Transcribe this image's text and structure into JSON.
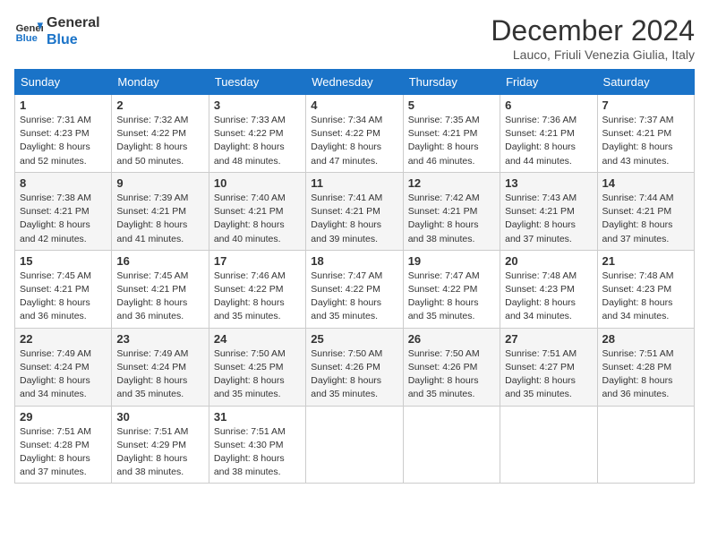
{
  "header": {
    "logo_line1": "General",
    "logo_line2": "Blue",
    "month_title": "December 2024",
    "subtitle": "Lauco, Friuli Venezia Giulia, Italy"
  },
  "weekdays": [
    "Sunday",
    "Monday",
    "Tuesday",
    "Wednesday",
    "Thursday",
    "Friday",
    "Saturday"
  ],
  "weeks": [
    [
      {
        "day": "1",
        "lines": [
          "Sunrise: 7:31 AM",
          "Sunset: 4:23 PM",
          "Daylight: 8 hours",
          "and 52 minutes."
        ]
      },
      {
        "day": "2",
        "lines": [
          "Sunrise: 7:32 AM",
          "Sunset: 4:22 PM",
          "Daylight: 8 hours",
          "and 50 minutes."
        ]
      },
      {
        "day": "3",
        "lines": [
          "Sunrise: 7:33 AM",
          "Sunset: 4:22 PM",
          "Daylight: 8 hours",
          "and 48 minutes."
        ]
      },
      {
        "day": "4",
        "lines": [
          "Sunrise: 7:34 AM",
          "Sunset: 4:22 PM",
          "Daylight: 8 hours",
          "and 47 minutes."
        ]
      },
      {
        "day": "5",
        "lines": [
          "Sunrise: 7:35 AM",
          "Sunset: 4:21 PM",
          "Daylight: 8 hours",
          "and 46 minutes."
        ]
      },
      {
        "day": "6",
        "lines": [
          "Sunrise: 7:36 AM",
          "Sunset: 4:21 PM",
          "Daylight: 8 hours",
          "and 44 minutes."
        ]
      },
      {
        "day": "7",
        "lines": [
          "Sunrise: 7:37 AM",
          "Sunset: 4:21 PM",
          "Daylight: 8 hours",
          "and 43 minutes."
        ]
      }
    ],
    [
      {
        "day": "8",
        "lines": [
          "Sunrise: 7:38 AM",
          "Sunset: 4:21 PM",
          "Daylight: 8 hours",
          "and 42 minutes."
        ]
      },
      {
        "day": "9",
        "lines": [
          "Sunrise: 7:39 AM",
          "Sunset: 4:21 PM",
          "Daylight: 8 hours",
          "and 41 minutes."
        ]
      },
      {
        "day": "10",
        "lines": [
          "Sunrise: 7:40 AM",
          "Sunset: 4:21 PM",
          "Daylight: 8 hours",
          "and 40 minutes."
        ]
      },
      {
        "day": "11",
        "lines": [
          "Sunrise: 7:41 AM",
          "Sunset: 4:21 PM",
          "Daylight: 8 hours",
          "and 39 minutes."
        ]
      },
      {
        "day": "12",
        "lines": [
          "Sunrise: 7:42 AM",
          "Sunset: 4:21 PM",
          "Daylight: 8 hours",
          "and 38 minutes."
        ]
      },
      {
        "day": "13",
        "lines": [
          "Sunrise: 7:43 AM",
          "Sunset: 4:21 PM",
          "Daylight: 8 hours",
          "and 37 minutes."
        ]
      },
      {
        "day": "14",
        "lines": [
          "Sunrise: 7:44 AM",
          "Sunset: 4:21 PM",
          "Daylight: 8 hours",
          "and 37 minutes."
        ]
      }
    ],
    [
      {
        "day": "15",
        "lines": [
          "Sunrise: 7:45 AM",
          "Sunset: 4:21 PM",
          "Daylight: 8 hours",
          "and 36 minutes."
        ]
      },
      {
        "day": "16",
        "lines": [
          "Sunrise: 7:45 AM",
          "Sunset: 4:21 PM",
          "Daylight: 8 hours",
          "and 36 minutes."
        ]
      },
      {
        "day": "17",
        "lines": [
          "Sunrise: 7:46 AM",
          "Sunset: 4:22 PM",
          "Daylight: 8 hours",
          "and 35 minutes."
        ]
      },
      {
        "day": "18",
        "lines": [
          "Sunrise: 7:47 AM",
          "Sunset: 4:22 PM",
          "Daylight: 8 hours",
          "and 35 minutes."
        ]
      },
      {
        "day": "19",
        "lines": [
          "Sunrise: 7:47 AM",
          "Sunset: 4:22 PM",
          "Daylight: 8 hours",
          "and 35 minutes."
        ]
      },
      {
        "day": "20",
        "lines": [
          "Sunrise: 7:48 AM",
          "Sunset: 4:23 PM",
          "Daylight: 8 hours",
          "and 34 minutes."
        ]
      },
      {
        "day": "21",
        "lines": [
          "Sunrise: 7:48 AM",
          "Sunset: 4:23 PM",
          "Daylight: 8 hours",
          "and 34 minutes."
        ]
      }
    ],
    [
      {
        "day": "22",
        "lines": [
          "Sunrise: 7:49 AM",
          "Sunset: 4:24 PM",
          "Daylight: 8 hours",
          "and 34 minutes."
        ]
      },
      {
        "day": "23",
        "lines": [
          "Sunrise: 7:49 AM",
          "Sunset: 4:24 PM",
          "Daylight: 8 hours",
          "and 35 minutes."
        ]
      },
      {
        "day": "24",
        "lines": [
          "Sunrise: 7:50 AM",
          "Sunset: 4:25 PM",
          "Daylight: 8 hours",
          "and 35 minutes."
        ]
      },
      {
        "day": "25",
        "lines": [
          "Sunrise: 7:50 AM",
          "Sunset: 4:26 PM",
          "Daylight: 8 hours",
          "and 35 minutes."
        ]
      },
      {
        "day": "26",
        "lines": [
          "Sunrise: 7:50 AM",
          "Sunset: 4:26 PM",
          "Daylight: 8 hours",
          "and 35 minutes."
        ]
      },
      {
        "day": "27",
        "lines": [
          "Sunrise: 7:51 AM",
          "Sunset: 4:27 PM",
          "Daylight: 8 hours",
          "and 35 minutes."
        ]
      },
      {
        "day": "28",
        "lines": [
          "Sunrise: 7:51 AM",
          "Sunset: 4:28 PM",
          "Daylight: 8 hours",
          "and 36 minutes."
        ]
      }
    ],
    [
      {
        "day": "29",
        "lines": [
          "Sunrise: 7:51 AM",
          "Sunset: 4:28 PM",
          "Daylight: 8 hours",
          "and 37 minutes."
        ]
      },
      {
        "day": "30",
        "lines": [
          "Sunrise: 7:51 AM",
          "Sunset: 4:29 PM",
          "Daylight: 8 hours",
          "and 38 minutes."
        ]
      },
      {
        "day": "31",
        "lines": [
          "Sunrise: 7:51 AM",
          "Sunset: 4:30 PM",
          "Daylight: 8 hours",
          "and 38 minutes."
        ]
      },
      null,
      null,
      null,
      null
    ]
  ]
}
